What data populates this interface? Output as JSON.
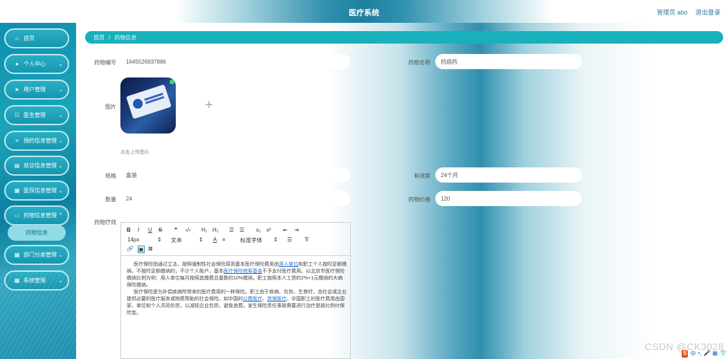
{
  "app": {
    "title": "医疗系统"
  },
  "header": {
    "user": "管理员 abo",
    "logout": "退出登录"
  },
  "sidebar": {
    "items": [
      {
        "label": "首页",
        "icon": "home-icon"
      },
      {
        "label": "个人中心",
        "icon": "user-icon"
      },
      {
        "label": "用户管理",
        "icon": "send-icon"
      },
      {
        "label": "医生管理",
        "icon": "list-icon"
      },
      {
        "label": "预约信息管理",
        "icon": "menu-icon"
      },
      {
        "label": "就诊信息管理",
        "icon": "clipboard-icon"
      },
      {
        "label": "医保信息管理",
        "icon": "grid-icon"
      },
      {
        "label": "药物信息管理",
        "icon": "monitor-icon"
      },
      {
        "label": "部门分类管理",
        "icon": "grid-icon"
      },
      {
        "label": "系统管理",
        "icon": "grid-icon"
      }
    ],
    "sub_item": "药物信息"
  },
  "breadcrumb": {
    "home": "首页",
    "separator": "/",
    "current": "药物信息"
  },
  "form": {
    "drug_no_label": "药物编号",
    "drug_no_value": "1645526937886",
    "drug_name_label": "药物名称",
    "drug_name_value": "抗癌药",
    "photo_label": "图片",
    "upload_plus": "+",
    "upload_hint": "点击上传图片",
    "spec_label": "规格",
    "spec_value": "盒装",
    "validity_label": "有效期",
    "validity_value": "24个月",
    "qty_label": "数量",
    "qty_value": "24",
    "price_label": "药物价格",
    "price_value": "120",
    "efficacy_label": "药物疗效"
  },
  "editor": {
    "toolbar": {
      "bold": "B",
      "italic": "I",
      "underline": "U",
      "strike": "S",
      "quote": "❞",
      "code": "‹/›",
      "h1": "H₁",
      "h2": "H₂",
      "ol": "☰",
      "ul": "☰",
      "sub": "x₂",
      "sup": "x²",
      "indent_left": "⇤",
      "indent_right": "⇥",
      "size": "14px",
      "style": "文本",
      "font": "标准字体",
      "color": "A",
      "align": "☰",
      "clean": "T̸"
    },
    "paragraph1_a": "医疗保险指通过立法，按照强制性社会保险原则基本医疗保险费用由",
    "link1": "用人单位",
    "paragraph1_b": "和职工个人按时足额缴纳，不按时足额缴纳的，不计个人账户，基本",
    "link2": "医疗保险统筹基金",
    "paragraph1_c": "不予支付医疗费用。以北京市医疗保险缴纳比例为例：用人单位每月按照其缴费总基数的10%缴纳，职工按照本人工资的2%+1元缴纳的大病保险缴纳。",
    "paragraph2_a": "医疗保险是为补偿疾病所带来的医疗费用的一种保险。职工由于疾病、负伤、生育时，由社会或企业提供必要的医疗服务或物质帮助的社会保险。如中国的",
    "link3": "公费医疗",
    "paragraph2_b": "、",
    "link4": "劳保医疗",
    "paragraph2_c": "。中国职工的医疗费用由国家、单位和个人共同负担，以减轻企业负担，避免浪费。发生保险责任事故需要进行治疗是按比例付保险金。"
  },
  "footer": {
    "watermark": "CSDN @CK3028"
  }
}
